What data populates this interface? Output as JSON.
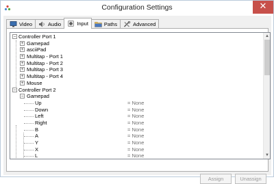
{
  "window": {
    "title": "Configuration Settings",
    "close_glyph": "✕"
  },
  "tabs": [
    {
      "label": "Video",
      "icon": "monitor-icon"
    },
    {
      "label": "Audio",
      "icon": "speaker-icon"
    },
    {
      "label": "Input",
      "icon": "joystick-icon",
      "active": true
    },
    {
      "label": "Paths",
      "icon": "folder-icon"
    },
    {
      "label": "Advanced",
      "icon": "tools-icon"
    }
  ],
  "tree": {
    "port1": {
      "label": "Controller Port 1",
      "expander": "−",
      "children": [
        "Gamepad",
        "asciiPad",
        "Multitap - Port 1",
        "Multitap - Port 2",
        "Multitap - Port 3",
        "Multitap - Port 4",
        "Mouse"
      ],
      "child_expander": "+"
    },
    "port2": {
      "label": "Controller Port 2",
      "expander": "−",
      "gamepad": {
        "label": "Gamepad",
        "expander": "−",
        "bindings": [
          {
            "name": "Up",
            "value": "= None"
          },
          {
            "name": "Down",
            "value": "= None"
          },
          {
            "name": "Left",
            "value": "= None"
          },
          {
            "name": "Right",
            "value": "= None"
          },
          {
            "name": "B",
            "value": "= None"
          },
          {
            "name": "A",
            "value": "= None"
          },
          {
            "name": "Y",
            "value": "= None"
          },
          {
            "name": "X",
            "value": "= None"
          },
          {
            "name": "L",
            "value": "= None"
          }
        ]
      }
    }
  },
  "scroll": {
    "up_glyph": "▲",
    "down_glyph": "▼"
  },
  "buttons": {
    "assign": "Assign",
    "unassign": "Unassign"
  }
}
